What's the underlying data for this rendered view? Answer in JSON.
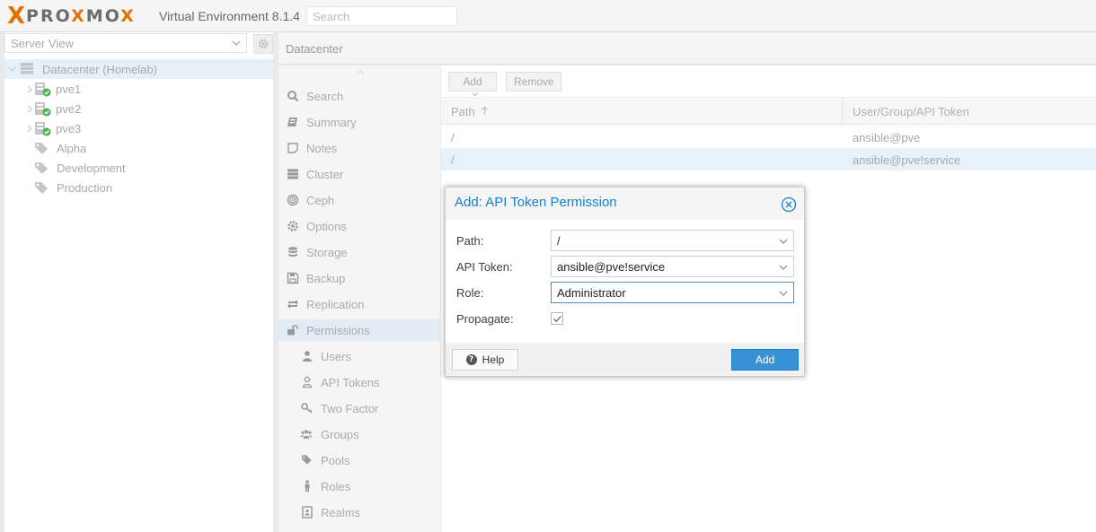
{
  "header": {
    "logo_text": "PROXMOX",
    "product_title": "Virtual Environment 8.1.4",
    "search_placeholder": "Search"
  },
  "left_panel": {
    "view": "Server View",
    "tree": [
      {
        "label": "Datacenter (Homelab)",
        "icon": "datacenter-icon"
      },
      {
        "label": "pve1",
        "icon": "node-online-icon"
      },
      {
        "label": "pve2",
        "icon": "node-online-icon"
      },
      {
        "label": "pve3",
        "icon": "node-online-icon"
      },
      {
        "label": "Alpha",
        "icon": "tag-icon"
      },
      {
        "label": "Development",
        "icon": "tag-icon"
      },
      {
        "label": "Production",
        "icon": "tag-icon"
      }
    ]
  },
  "breadcrumb": "Datacenter",
  "nav": {
    "items": [
      {
        "label": "Search",
        "icon": "search-icon"
      },
      {
        "label": "Summary",
        "icon": "summary-icon"
      },
      {
        "label": "Notes",
        "icon": "notes-icon"
      },
      {
        "label": "Cluster",
        "icon": "cluster-icon"
      },
      {
        "label": "Ceph",
        "icon": "ceph-icon"
      },
      {
        "label": "Options",
        "icon": "gear-icon"
      },
      {
        "label": "Storage",
        "icon": "database-icon"
      },
      {
        "label": "Backup",
        "icon": "floppy-icon"
      },
      {
        "label": "Replication",
        "icon": "replication-icon"
      },
      {
        "label": "Permissions",
        "icon": "unlock-icon"
      },
      {
        "label": "Users",
        "icon": "user-icon"
      },
      {
        "label": "API Tokens",
        "icon": "user-outline-icon"
      },
      {
        "label": "Two Factor",
        "icon": "key-icon"
      },
      {
        "label": "Groups",
        "icon": "users-icon"
      },
      {
        "label": "Pools",
        "icon": "tags-icon"
      },
      {
        "label": "Roles",
        "icon": "male-icon"
      },
      {
        "label": "Realms",
        "icon": "address-book-icon"
      }
    ]
  },
  "toolbar": {
    "add_label": "Add",
    "remove_label": "Remove"
  },
  "grid": {
    "columns": [
      "Path",
      "User/Group/API Token"
    ],
    "rows": [
      {
        "path": "/",
        "user": "ansible@pve"
      },
      {
        "path": "/",
        "user": "ansible@pve!service"
      }
    ]
  },
  "dialog": {
    "title": "Add: API Token Permission",
    "fields": {
      "path_label": "Path:",
      "path_value": "/",
      "token_label": "API Token:",
      "token_value": "ansible@pve!service",
      "role_label": "Role:",
      "role_value": "Administrator",
      "propagate_label": "Propagate:"
    },
    "propagate_checked": true,
    "help_label": "Help",
    "add_label": "Add"
  },
  "colors": {
    "brand_orange": "#e57000",
    "accent_blue": "#157fcc",
    "status_green": "#4caf50"
  }
}
